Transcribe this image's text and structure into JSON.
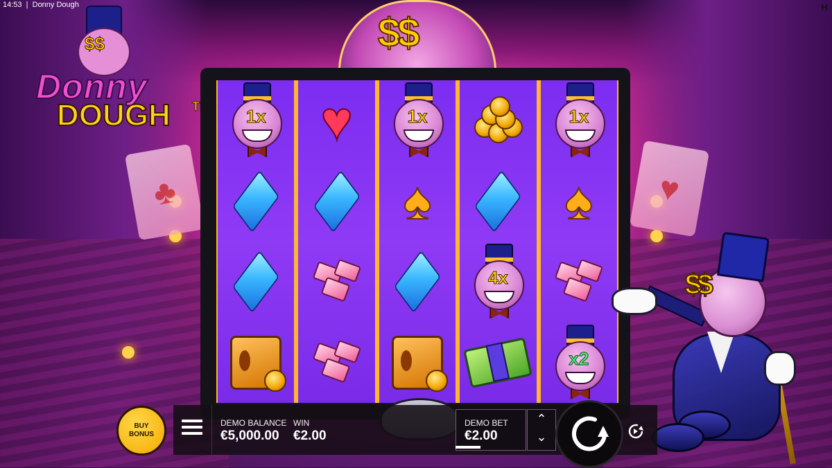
{
  "statusbar": {
    "time": "14:53",
    "title": "Donny Dough"
  },
  "logo": {
    "line1": "Donny",
    "line2": "DOUGH",
    "tm": "TM",
    "eyes": "$$"
  },
  "marquee": {
    "text": "$$"
  },
  "cards": {
    "left_suit": "♣",
    "right_suit": "♥"
  },
  "reels": [
    [
      {
        "type": "donny",
        "mult": "1x"
      },
      {
        "type": "diamond"
      },
      {
        "type": "diamond"
      },
      {
        "type": "safe"
      }
    ],
    [
      {
        "type": "heart"
      },
      {
        "type": "diamond"
      },
      {
        "type": "gems"
      },
      {
        "type": "gems"
      }
    ],
    [
      {
        "type": "donny",
        "mult": "1x"
      },
      {
        "type": "spade"
      },
      {
        "type": "diamond"
      },
      {
        "type": "safe"
      }
    ],
    [
      {
        "type": "coins"
      },
      {
        "type": "diamond"
      },
      {
        "type": "donny",
        "mult": "4x"
      },
      {
        "type": "cash"
      }
    ],
    [
      {
        "type": "donny",
        "mult": "1x"
      },
      {
        "type": "spade"
      },
      {
        "type": "gems"
      },
      {
        "type": "donny",
        "mult": "x2",
        "green": true
      }
    ]
  ],
  "host": {
    "eyes": "$$"
  },
  "hud": {
    "buy_bonus": "BUY BONUS",
    "balance_label": "DEMO BALANCE",
    "balance_value": "€5,000.00",
    "win_label": "WIN",
    "win_value": "€2.00",
    "bet_label": "DEMO BET",
    "bet_value": "€2.00",
    "up_arrow": "⌃",
    "down_arrow": "⌄"
  },
  "corner_logo": "H",
  "colors": {
    "reel_bg": "#8a34f2",
    "reel_divider": "#ffb52e",
    "gold": "#ffcf00",
    "hud_bg": "#140e14"
  }
}
